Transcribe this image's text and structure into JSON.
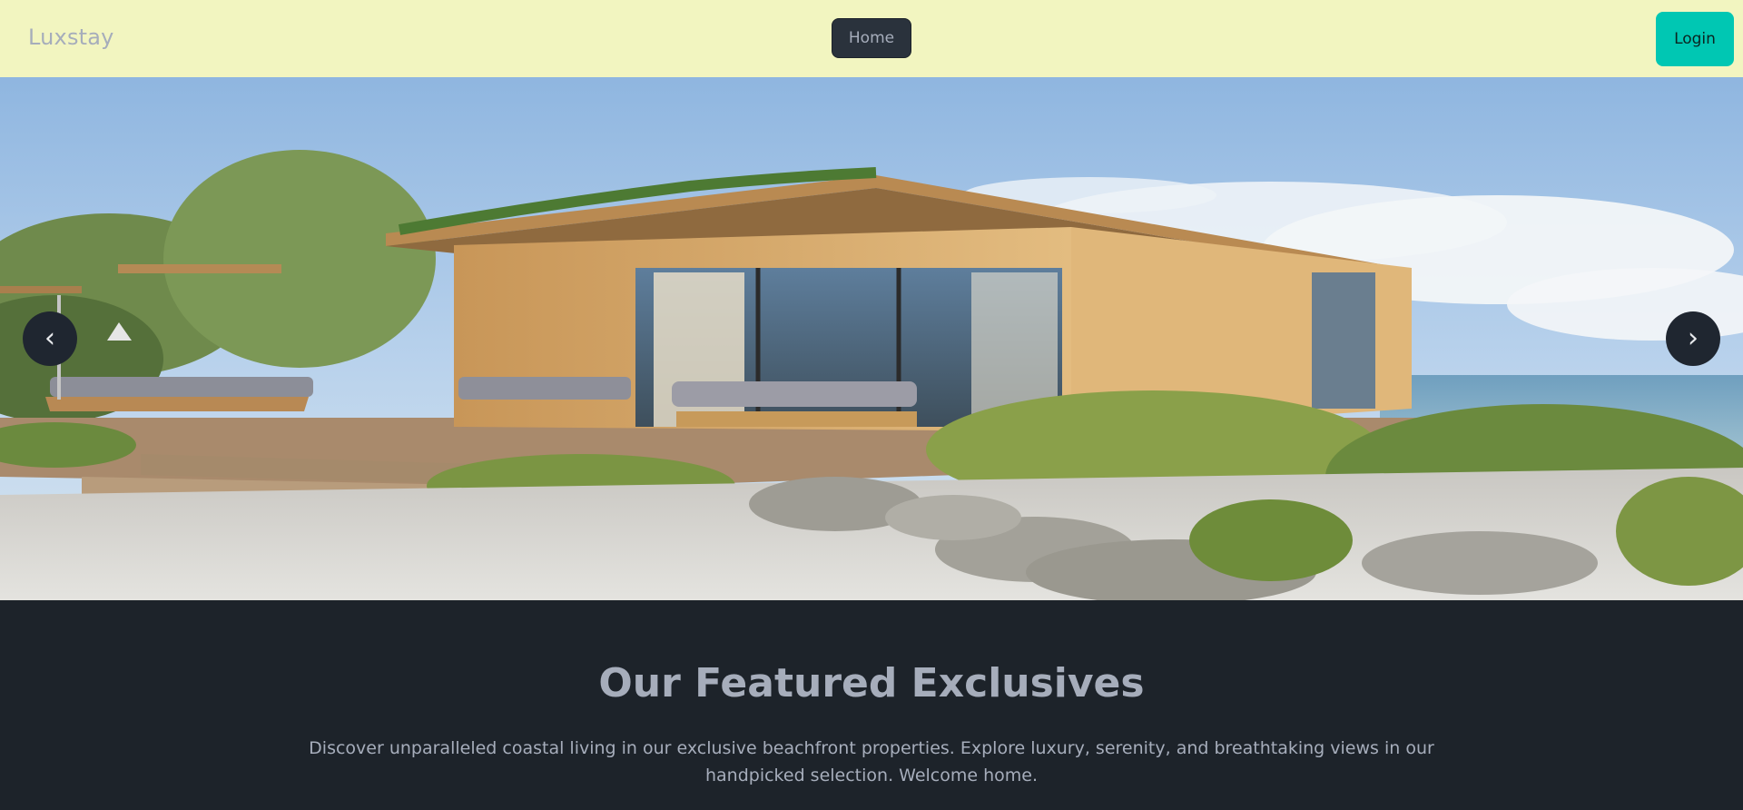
{
  "navbar": {
    "brand": "Luxstay",
    "home_label": "Home",
    "login_label": "Login"
  },
  "hero": {
    "prev_glyph": "‹",
    "next_glyph": "›"
  },
  "featured": {
    "title": "Our Featured Exclusives",
    "description": "Discover unparalleled coastal living in our exclusive beachfront properties. Explore luxury, serenity, and breathtaking views in our handpicked selection. Welcome home."
  },
  "colors": {
    "navbar_bg": "#f2f5c0",
    "accent": "#00c7b3",
    "dark_bg": "#1d232a",
    "muted_text": "#a6adbb"
  }
}
